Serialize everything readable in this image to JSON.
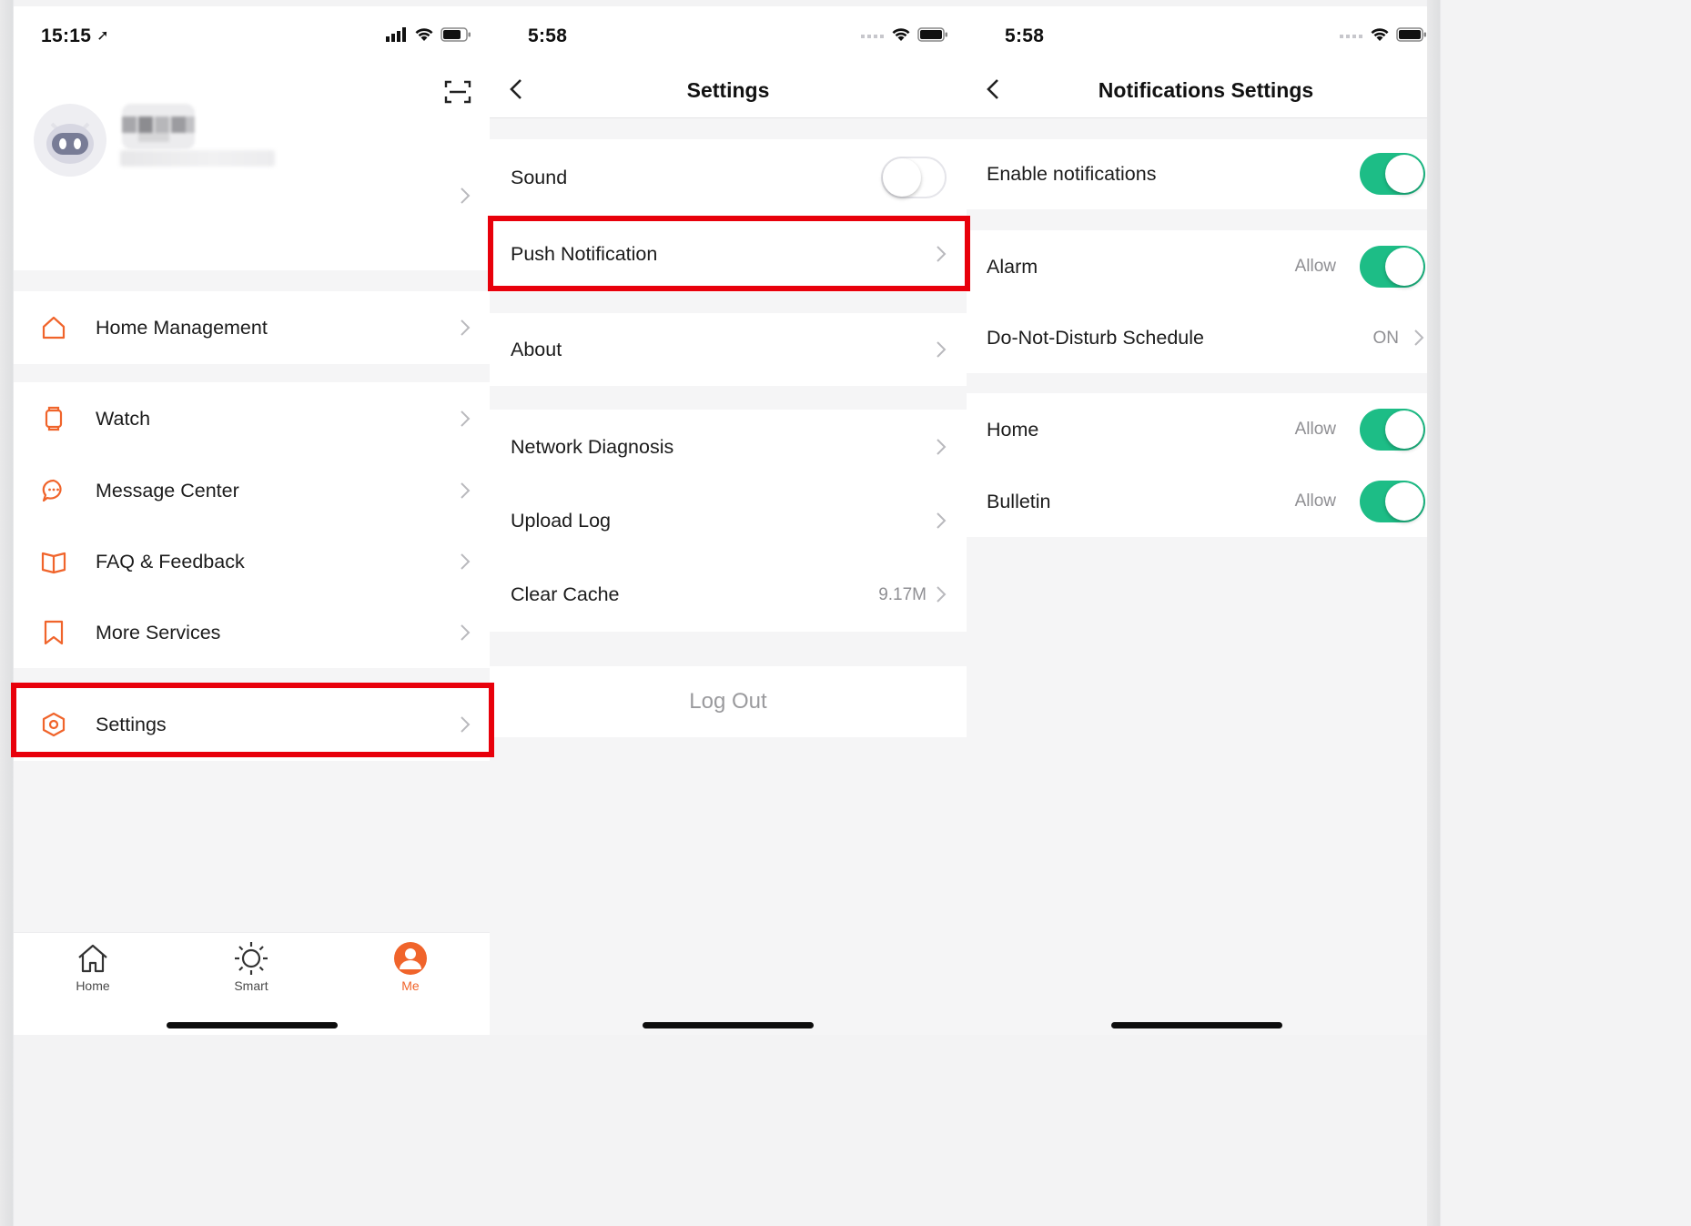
{
  "screen1": {
    "status_time": "15:15",
    "menu_groups": [
      [
        {
          "label": "Home Management",
          "icon": "house-icon"
        }
      ],
      [
        {
          "label": "Watch",
          "icon": "watch-icon"
        },
        {
          "label": "Message Center",
          "icon": "message-bubble-icon"
        },
        {
          "label": "FAQ & Feedback",
          "icon": "book-icon"
        },
        {
          "label": "More Services",
          "icon": "bookmark-icon"
        }
      ],
      [
        {
          "label": "Settings",
          "icon": "hexagon-settings-icon"
        }
      ]
    ],
    "tabs": [
      {
        "label": "Home",
        "icon": "house-outline-icon",
        "active": false
      },
      {
        "label": "Smart",
        "icon": "sun-icon",
        "active": false
      },
      {
        "label": "Me",
        "icon": "person-filled-icon",
        "active": true
      }
    ]
  },
  "screen2": {
    "status_time": "5:58",
    "title": "Settings",
    "sound_label": "Sound",
    "sound_on": false,
    "push_label": "Push Notification",
    "about_label": "About",
    "network_label": "Network Diagnosis",
    "upload_label": "Upload Log",
    "cache_label": "Clear Cache",
    "cache_value": "9.17M",
    "logout_label": "Log Out"
  },
  "screen3": {
    "status_time": "5:58",
    "title": "Notifications Settings",
    "enable_label": "Enable notifications",
    "enable_on": true,
    "alarm_label": "Alarm",
    "alarm_value": "Allow",
    "dnd_label": "Do-Not-Disturb Schedule",
    "dnd_value": "ON",
    "home_label": "Home",
    "home_value": "Allow",
    "bulletin_label": "Bulletin",
    "bulletin_value": "Allow"
  },
  "colors": {
    "accent_orange": "#f0642b",
    "toggle_green": "#1dbd86",
    "highlight_red": "#e8000b"
  }
}
